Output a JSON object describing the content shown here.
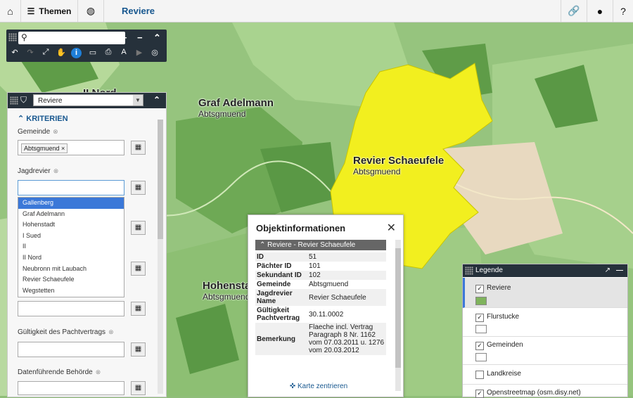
{
  "topbar": {
    "home_icon": "home-icon",
    "themen_label": "Themen",
    "title": "Reviere"
  },
  "map": {
    "labels": [
      {
        "name": "Graf Adelmann",
        "sub": "Abtsgmuend"
      },
      {
        "name": "Revier Schaeufele",
        "sub": "Abtsgmuend"
      },
      {
        "name": "Hohenstad",
        "sub": "Abtsgmuend"
      },
      {
        "name": "II Nord",
        "sub": ""
      }
    ],
    "highlight_color": "#f2ef1f"
  },
  "filter": {
    "layer_select": "Reviere",
    "section": "KRITERIEN",
    "gemeinde_label": "Gemeinde",
    "gemeinde_tag": "Abtsgmuend",
    "jagdrevier_label": "Jagdrevier",
    "gueltigkeit_label": "Gültigkeit des Pachtvertrags",
    "behoerde_label": "Datenführende Behörde",
    "options": [
      "Gallenberg",
      "Graf Adelmann",
      "Hohenstadt",
      "I Sued",
      "II",
      "II Nord",
      "Neubronn mit Laubach",
      "Revier Schaeufele",
      "Wegstetten"
    ],
    "selected_option": "Gallenberg"
  },
  "popup": {
    "title": "Objektinformationen",
    "section": "Reviere - Revier Schaeufele",
    "rows": [
      {
        "k": "ID",
        "v": "51"
      },
      {
        "k": "Pächter ID",
        "v": "101"
      },
      {
        "k": "Sekundant ID",
        "v": "102"
      },
      {
        "k": "Gemeinde",
        "v": "Abtsgmuend"
      },
      {
        "k": "Jagdrevier Name",
        "v": "Revier Schaeufele"
      },
      {
        "k": "Gültigkeit Pachtvertrag",
        "v": "30.11.0002"
      },
      {
        "k": "Bemerkung",
        "v": "Flaeche incl. Vertrag Paragraph 8 Nr. 1162 vom 07.03.2011 u. 1276 vom 20.03.2012"
      }
    ],
    "center_link": "Karte zentrieren"
  },
  "legend": {
    "title": "Legende",
    "items": [
      {
        "name": "Reviere",
        "checked": true,
        "color": "#7fb35c"
      },
      {
        "name": "Flurstucke",
        "checked": true,
        "color": "#ffffff"
      },
      {
        "name": "Gemeinden",
        "checked": true,
        "color": "#ffffff"
      },
      {
        "name": "Landkreise",
        "checked": false
      },
      {
        "name": "Openstreetmap (osm.disy.net)",
        "checked": true
      }
    ]
  }
}
